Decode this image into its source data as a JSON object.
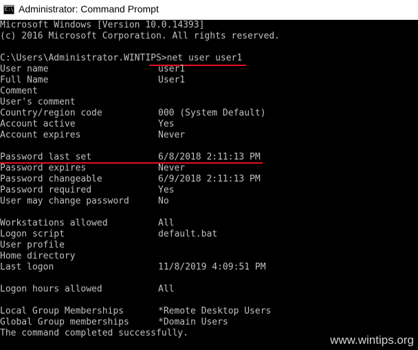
{
  "window": {
    "title": "Administrator: Command Prompt",
    "icon": "cmd-icon"
  },
  "console": {
    "header_line1": "Microsoft Windows [Version 10.0.14393]",
    "header_line2": "(c) 2016 Microsoft Corporation. All rights reserved.",
    "prompt": "C:\\Users\\Administrator.WINTIPS>",
    "command": "net user user1",
    "rows": [
      {
        "label": "User name",
        "value": "user1"
      },
      {
        "label": "Full Name",
        "value": "User1"
      },
      {
        "label": "Comment",
        "value": ""
      },
      {
        "label": "User's comment",
        "value": ""
      },
      {
        "label": "Country/region code",
        "value": "000 (System Default)"
      },
      {
        "label": "Account active",
        "value": "Yes"
      },
      {
        "label": "Account expires",
        "value": "Never"
      },
      {
        "label": "Password last set",
        "value": "6/8/2018 2:11:13 PM"
      },
      {
        "label": "Password expires",
        "value": "Never"
      },
      {
        "label": "Password changeable",
        "value": "6/9/2018 2:11:13 PM"
      },
      {
        "label": "Password required",
        "value": "Yes"
      },
      {
        "label": "User may change password",
        "value": "No"
      },
      {
        "label": "Workstations allowed",
        "value": "All"
      },
      {
        "label": "Logon script",
        "value": "default.bat"
      },
      {
        "label": "User profile",
        "value": ""
      },
      {
        "label": "Home directory",
        "value": ""
      },
      {
        "label": "Last logon",
        "value": "11/8/2019 4:09:51 PM"
      },
      {
        "label": "Logon hours allowed",
        "value": "All"
      },
      {
        "label": "Local Group Memberships",
        "value": "*Remote Desktop Users"
      },
      {
        "label": "Global Group memberships",
        "value": "*Domain Users"
      }
    ],
    "footer": "The command completed successfully."
  },
  "watermark": "www.wintips.org",
  "colors": {
    "text": "#c0c0c0",
    "background": "#000000",
    "highlight": "#e8101b"
  }
}
